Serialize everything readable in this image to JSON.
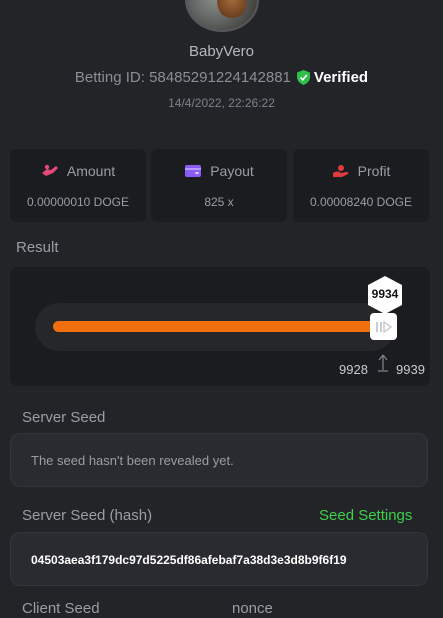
{
  "profile": {
    "username": "BabyVero",
    "betting_id_label": "Betting ID: 58485291224142881",
    "verified_label": "Verified",
    "timestamp": "14/4/2022, 22:26:22"
  },
  "stats": [
    {
      "label": "Amount",
      "value": "0.00000010 DOGE",
      "icon": "coins-icon",
      "icon_color": "#e8477a"
    },
    {
      "label": "Payout",
      "value": "825 x",
      "icon": "wallet-icon",
      "icon_color": "#8a5cf5"
    },
    {
      "label": "Profit",
      "value": "0.00008240 DOGE",
      "icon": "hand-coin-icon",
      "icon_color": "#e03b3b"
    }
  ],
  "result": {
    "label": "Result",
    "value": "9934",
    "marker_left": "9928",
    "marker_right": "9939",
    "bar_color": "#f0700f"
  },
  "server_seed": {
    "label": "Server Seed",
    "value": "The seed hasn't been revealed yet."
  },
  "server_seed_hash": {
    "label": "Server Seed (hash)",
    "link": "Seed Settings",
    "value": "04503aea3f179dc97d5225df86afebaf7a38d3e3d8b9f6f19"
  },
  "client_seed": {
    "label": "Client Seed",
    "nonce_label": "nonce"
  },
  "colors": {
    "background": "#232428",
    "card": "#1b1c1f",
    "accent_green": "#3ecf4c",
    "verified_green": "#2fbf4a"
  }
}
